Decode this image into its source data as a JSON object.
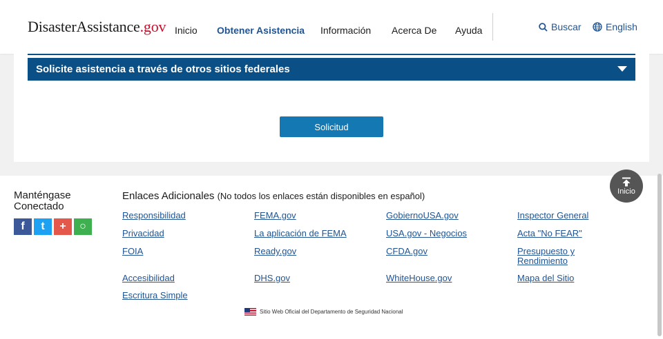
{
  "header": {
    "logo": {
      "part1": "Disaster",
      "part2": "Assistance",
      "part3": ".gov"
    },
    "nav": [
      "Inicio",
      "Obtener Asistencia",
      "Información",
      "Acerca De",
      "Ayuda"
    ],
    "search_label": "Buscar",
    "language_label": "English"
  },
  "accordion": {
    "title": "Solicite asistencia a través de otros sitios federales"
  },
  "apply_button": "Solicitud",
  "footer": {
    "stay_connected": "Manténgase Conectado",
    "social": [
      "f",
      "t",
      "+",
      "○"
    ],
    "links_title": "Enlaces Adicionales",
    "links_note": "(No todos los enlaces están disponibles en español)",
    "links": {
      "col1": [
        "Responsibilidad",
        "Privacidad",
        "FOIA",
        "Accesibilidad",
        "Escritura Simple"
      ],
      "col2": [
        "FEMA.gov",
        "La aplicación de FEMA",
        "Ready.gov",
        "DHS.gov"
      ],
      "col3": [
        "GobiernoUSA.gov",
        "USA.gov - Negocios",
        "CFDA.gov",
        "WhiteHouse.gov"
      ],
      "col4": [
        "Inspector General",
        "Acta \"No FEAR\"",
        "Presupuesto y Rendimiento",
        "Mapa del Sitio"
      ]
    },
    "official_site": "Sitio Web Oficial del Departamento de Seguridad Nacional"
  },
  "back_to_top": "Inicio",
  "colors": {
    "primary": "#0b4f87",
    "button": "#1479b3",
    "link": "#205493",
    "logo_dot": "#c8102e"
  }
}
